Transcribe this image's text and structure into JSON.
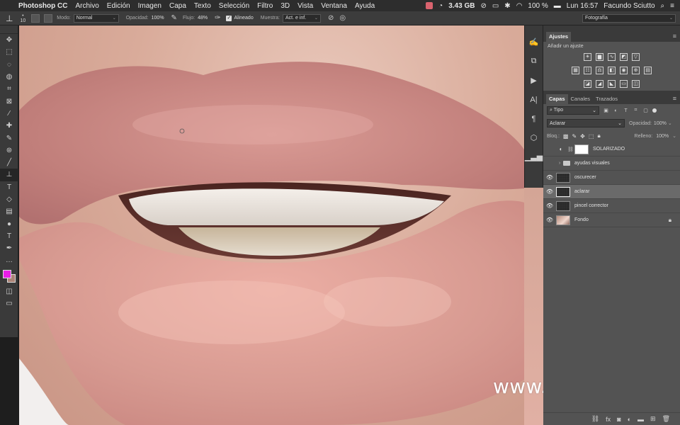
{
  "menubar": {
    "app_name": "Photoshop CC",
    "items": [
      "Archivo",
      "Edición",
      "Imagen",
      "Capa",
      "Texto",
      "Selección",
      "Filtro",
      "3D",
      "Vista",
      "Ventana",
      "Ayuda"
    ],
    "memory": "3.43 GB",
    "battery": "100 %",
    "clock": "Lun 16:57",
    "user": "Facundo Sciutto"
  },
  "options": {
    "brush_size": "10",
    "mode_label": "Modo:",
    "mode_value": "Normal",
    "opacity_label": "Opacidad:",
    "opacity_value": "100%",
    "flow_label": "Flujo:",
    "flow_value": "48%",
    "aligned_label": "Alineado",
    "sample_label": "Muestra:",
    "sample_value": "Act. e inf.",
    "workspace": "Fotografía"
  },
  "tools": [
    "move",
    "marquee",
    "lasso",
    "quick-select",
    "crop",
    "eyedropper-frame",
    "eyedropper",
    "healing",
    "brush-mini",
    "patch",
    "brush",
    "clone-stamp",
    "history-brush",
    "eraser",
    "gradient",
    "dodge",
    "pen",
    "type",
    "path-select",
    "more"
  ],
  "colors": {
    "foreground": "#e91ee6",
    "background": "#ad8477"
  },
  "adjustments": {
    "tab": "Ajustes",
    "subtitle": "Añadir un ajuste"
  },
  "layers_panel": {
    "tabs": [
      "Capas",
      "Canales",
      "Trazados"
    ],
    "filter": "Tipo",
    "blend_mode": "Aclarar",
    "opacity_label": "Opacidad:",
    "opacity_value": "100%",
    "lock_label": "Bloq.:",
    "fill_label": "Relleno:",
    "fill_value": "100%",
    "layers": [
      {
        "name": "SOLARIZADO",
        "visible": false
      },
      {
        "name": "ayudas visuales",
        "visible": false
      },
      {
        "name": "oscurecer",
        "visible": true
      },
      {
        "name": "aclarar",
        "visible": true,
        "selected": true
      },
      {
        "name": "pincel corrector",
        "visible": true
      },
      {
        "name": "Fondo",
        "visible": true,
        "locked": true
      }
    ]
  },
  "watermark": "www.hunls.com"
}
